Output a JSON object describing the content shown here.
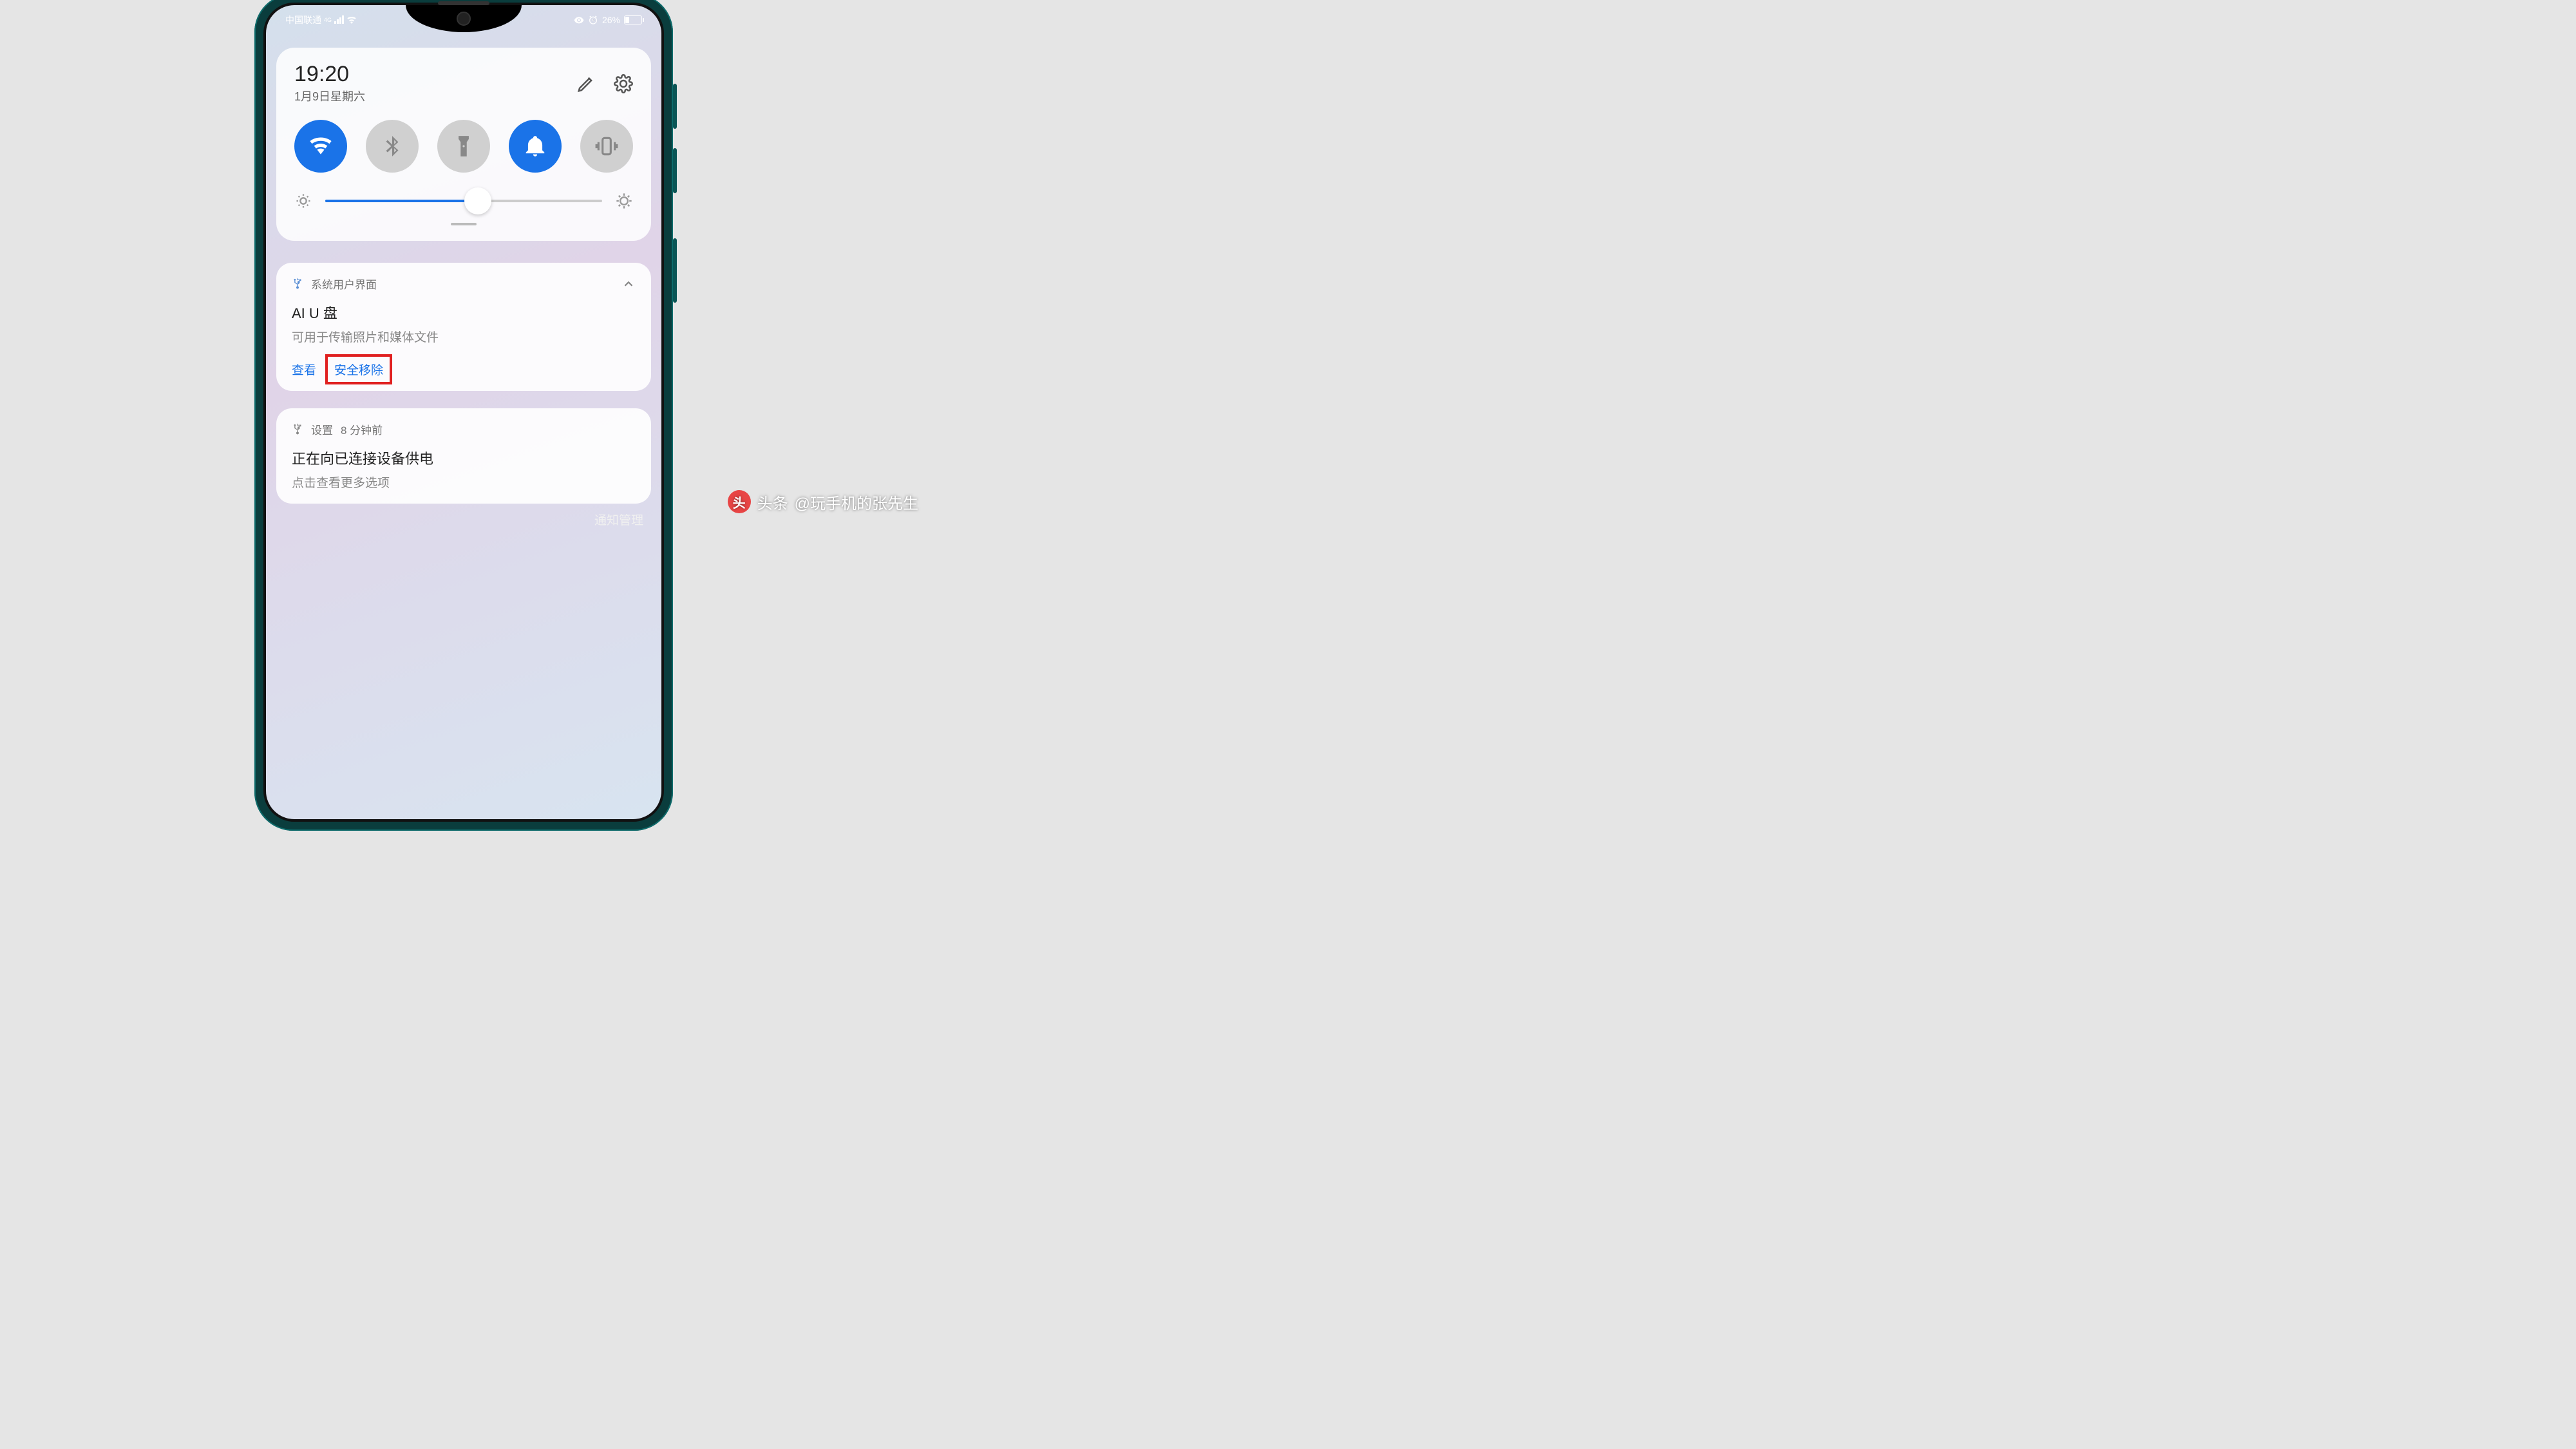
{
  "status_bar": {
    "carrier": "中国联通",
    "network_badge": "4G",
    "battery_percent": "26%",
    "battery_level": 26
  },
  "panel": {
    "time": "19:20",
    "date": "1月9日星期六"
  },
  "toggles": {
    "wifi_active": true,
    "bluetooth_active": false,
    "flashlight_active": false,
    "dnd_active": true,
    "vibrate_active": false
  },
  "brightness": {
    "value": 55
  },
  "notification1": {
    "app": "系统用户界面",
    "title": "AI U 盘",
    "body": "可用于传输照片和媒体文件",
    "action_view": "查看",
    "action_eject": "安全移除"
  },
  "notification2": {
    "app": "设置",
    "time": "8 分钟前",
    "title": "正在向已连接设备供电",
    "body": "点击查看更多选项"
  },
  "footer": {
    "manage": "通知管理"
  },
  "watermark": {
    "brand": "头条",
    "handle": "@玩手机的张先生"
  }
}
